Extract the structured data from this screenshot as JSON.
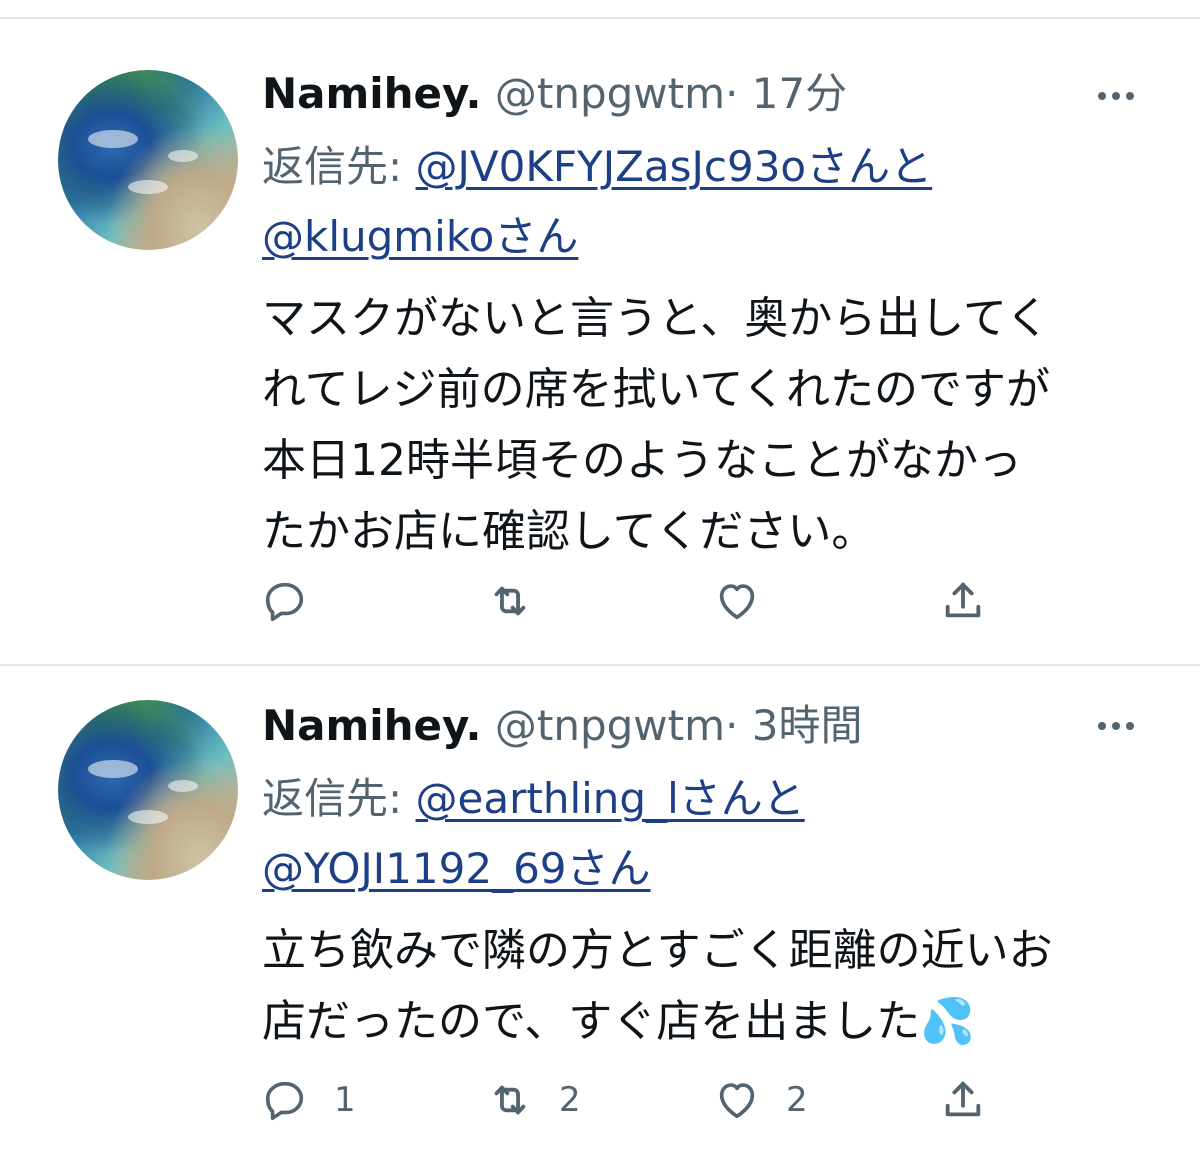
{
  "tweets": [
    {
      "display_name": "Namihey.",
      "handle": "@tnpgwtm",
      "separator": "·",
      "time": "17分",
      "reply_prefix": "返信先:",
      "reply_mention_1": "@JV0KFYJZasJc93oさんと",
      "reply_mention_2": "@klugmikoさん",
      "text": "マスクがないと言うと、奥から出してく\nれてレジ前の席を拭いてくれたのですが\n本日12時半頃そのようなことがなかっ\nたかお店に確認してください。",
      "reply_count": "",
      "retweet_count": "",
      "like_count": ""
    },
    {
      "display_name": "Namihey.",
      "handle": "@tnpgwtm",
      "separator": "·",
      "time": "3時間",
      "reply_prefix": "返信先:",
      "reply_mention_1": "@earthling_lさんと",
      "reply_mention_2": "@YOJI1192_69さん",
      "text": "立ち飲みで隣の方とすごく距離の近いお\n店だったので、すぐ店を出ました💦",
      "reply_count": "1",
      "retweet_count": "2",
      "like_count": "2"
    }
  ],
  "icons": [
    "more-icon",
    "reply-icon",
    "retweet-icon",
    "like-icon",
    "share-icon"
  ],
  "colors": {
    "text": "#0f1419",
    "secondary": "#536471",
    "mention": "#1d3f86",
    "divider": "#e3e6e9"
  }
}
